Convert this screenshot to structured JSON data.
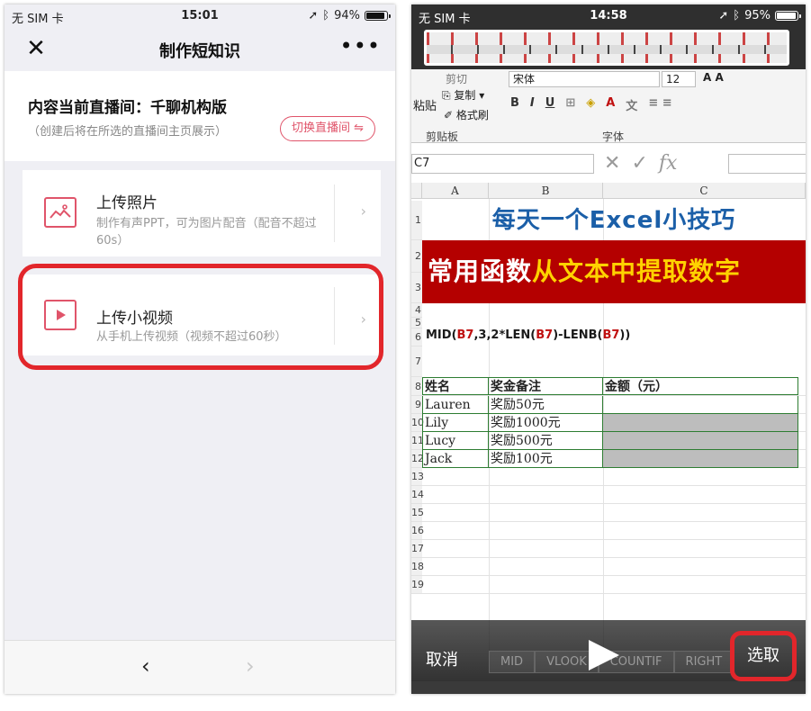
{
  "left": {
    "status": {
      "carrier": "无 SIM 卡",
      "time": "15:01",
      "battery": "94%"
    },
    "nav": {
      "close": "✕",
      "title": "制作短知识",
      "more": "•••"
    },
    "live": {
      "name": "内容当前直播间：千聊机构版",
      "hint": "（创建后将在所选的直播间主页展示）",
      "switch_label": "切换直播间 ⇋"
    },
    "items": [
      {
        "title": "上传照片",
        "desc": "制作有声PPT，可为图片配音（配音不超过60s）"
      },
      {
        "title": "上传小视频",
        "desc": "从手机上传视频（视频不超过60秒）"
      }
    ],
    "bottom": {
      "back": "‹",
      "forward": "›"
    }
  },
  "right": {
    "status": {
      "carrier": "无 SIM 卡",
      "time": "14:58",
      "battery": "95%"
    },
    "ribbon": {
      "paste": "粘贴",
      "cut": "剪切",
      "copy": "复制",
      "format_painter": "格式刷",
      "clipboard": "剪贴板",
      "font_name": "宋体",
      "font_size": "12",
      "font_group": "字体",
      "bold": "B",
      "italic": "I",
      "underline": "U"
    },
    "formula_bar": {
      "namebox": "C7",
      "fx": "fx"
    },
    "columns": [
      "A",
      "B",
      "C"
    ],
    "row_numbers": [
      "1",
      "2",
      "3",
      "4",
      "5",
      "6",
      "7",
      "8",
      "9",
      "10",
      "11",
      "12",
      "13",
      "14",
      "15",
      "16",
      "17",
      "18",
      "19"
    ],
    "sheet": {
      "title1": "每天一个Excel小技巧",
      "title2_white": "常用函数",
      "title2_yellow": "从文本中提取数字",
      "formula_parts": [
        "MID(",
        "B7",
        ",3,2*LEN(",
        "B7",
        ")-LENB(",
        "B7",
        "))"
      ],
      "table": {
        "headers": [
          "姓名",
          "奖金备注",
          "金额（元）"
        ],
        "rows": [
          [
            "Lauren",
            "奖励50元",
            ""
          ],
          [
            "Lily",
            "奖励1000元",
            ""
          ],
          [
            "Lucy",
            "奖励500元",
            ""
          ],
          [
            "Jack",
            "奖励100元",
            ""
          ]
        ]
      }
    },
    "sheet_tabs": [
      "MID",
      "VLOOK",
      "COUNTIF",
      "RIGHT"
    ],
    "controls": {
      "cancel": "取消",
      "select": "选取"
    }
  }
}
